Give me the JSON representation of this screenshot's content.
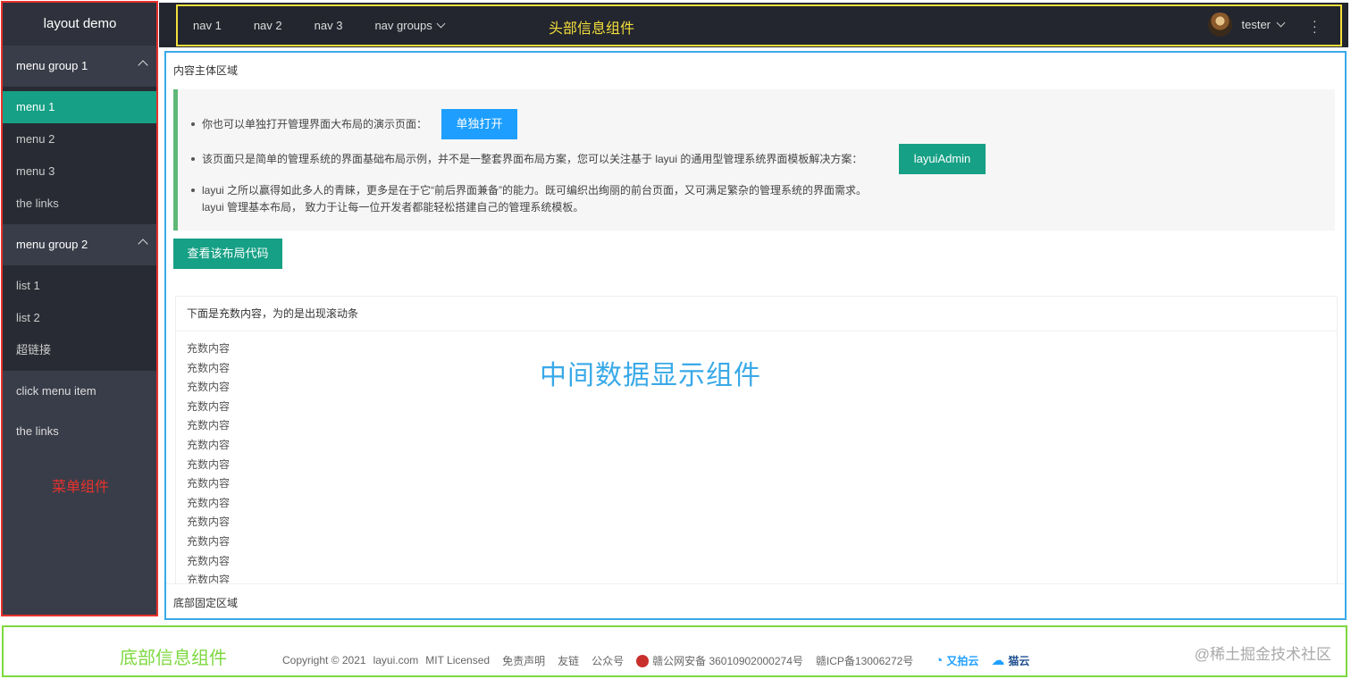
{
  "sidebar": {
    "logo": "layout demo",
    "group1": {
      "label": "menu group 1",
      "items": [
        "menu 1",
        "menu 2",
        "menu 3",
        "the links"
      ]
    },
    "group2": {
      "label": "menu group 2",
      "items": [
        "list 1",
        "list 2",
        "超链接"
      ]
    },
    "extra_items": [
      "click menu item",
      "the links"
    ],
    "annotation": "菜单组件"
  },
  "header": {
    "nav": [
      "nav 1",
      "nav 2",
      "nav 3",
      "nav groups"
    ],
    "annotation": "头部信息组件",
    "user": "tester"
  },
  "content": {
    "title": "内容主体区域",
    "tips": [
      "你也可以单独打开管理界面大布局的演示页面：",
      "该页面只是简单的管理系统的界面基础布局示例，并不是一整套界面布局方案，您可以关注基于 layui 的通用型管理系统界面模板解决方案：",
      "layui 之所以赢得如此多人的青睐，更多是在于它“前后界面兼备”的能力。既可编织出绚丽的前台页面，又可满足繁杂的管理系统的界面需求。",
      "layui 管理基本布局， 致力于让每一位开发者都能轻松搭建自己的管理系统模板。"
    ],
    "open_button": "单独打开",
    "admin_button": "layuiAdmin",
    "view_code_button": "查看该布局代码",
    "card_title": "下面是充数内容，为的是出现滚动条",
    "fill_text": "充数内容",
    "annotation": "中间数据显示组件",
    "footer_text": "底部固定区域"
  },
  "footer": {
    "annotation": "底部信息组件",
    "copyright": "Copyright © 2021",
    "site": "layui.com",
    "license": "MIT Licensed",
    "disclaimer": "免责声明",
    "links": "友链",
    "wechat": "公众号",
    "police": "赣公网安备 36010902000274号",
    "icp": "赣ICP备13006272号",
    "sponsor1": "又拍云",
    "sponsor2": "猫云",
    "watermark": "@稀土掘金技术社区"
  },
  "colors": {
    "sidebar_bg": "#393d49",
    "header_bg": "#23262e",
    "active": "#16a085",
    "blue_button": "#1e9fff"
  }
}
